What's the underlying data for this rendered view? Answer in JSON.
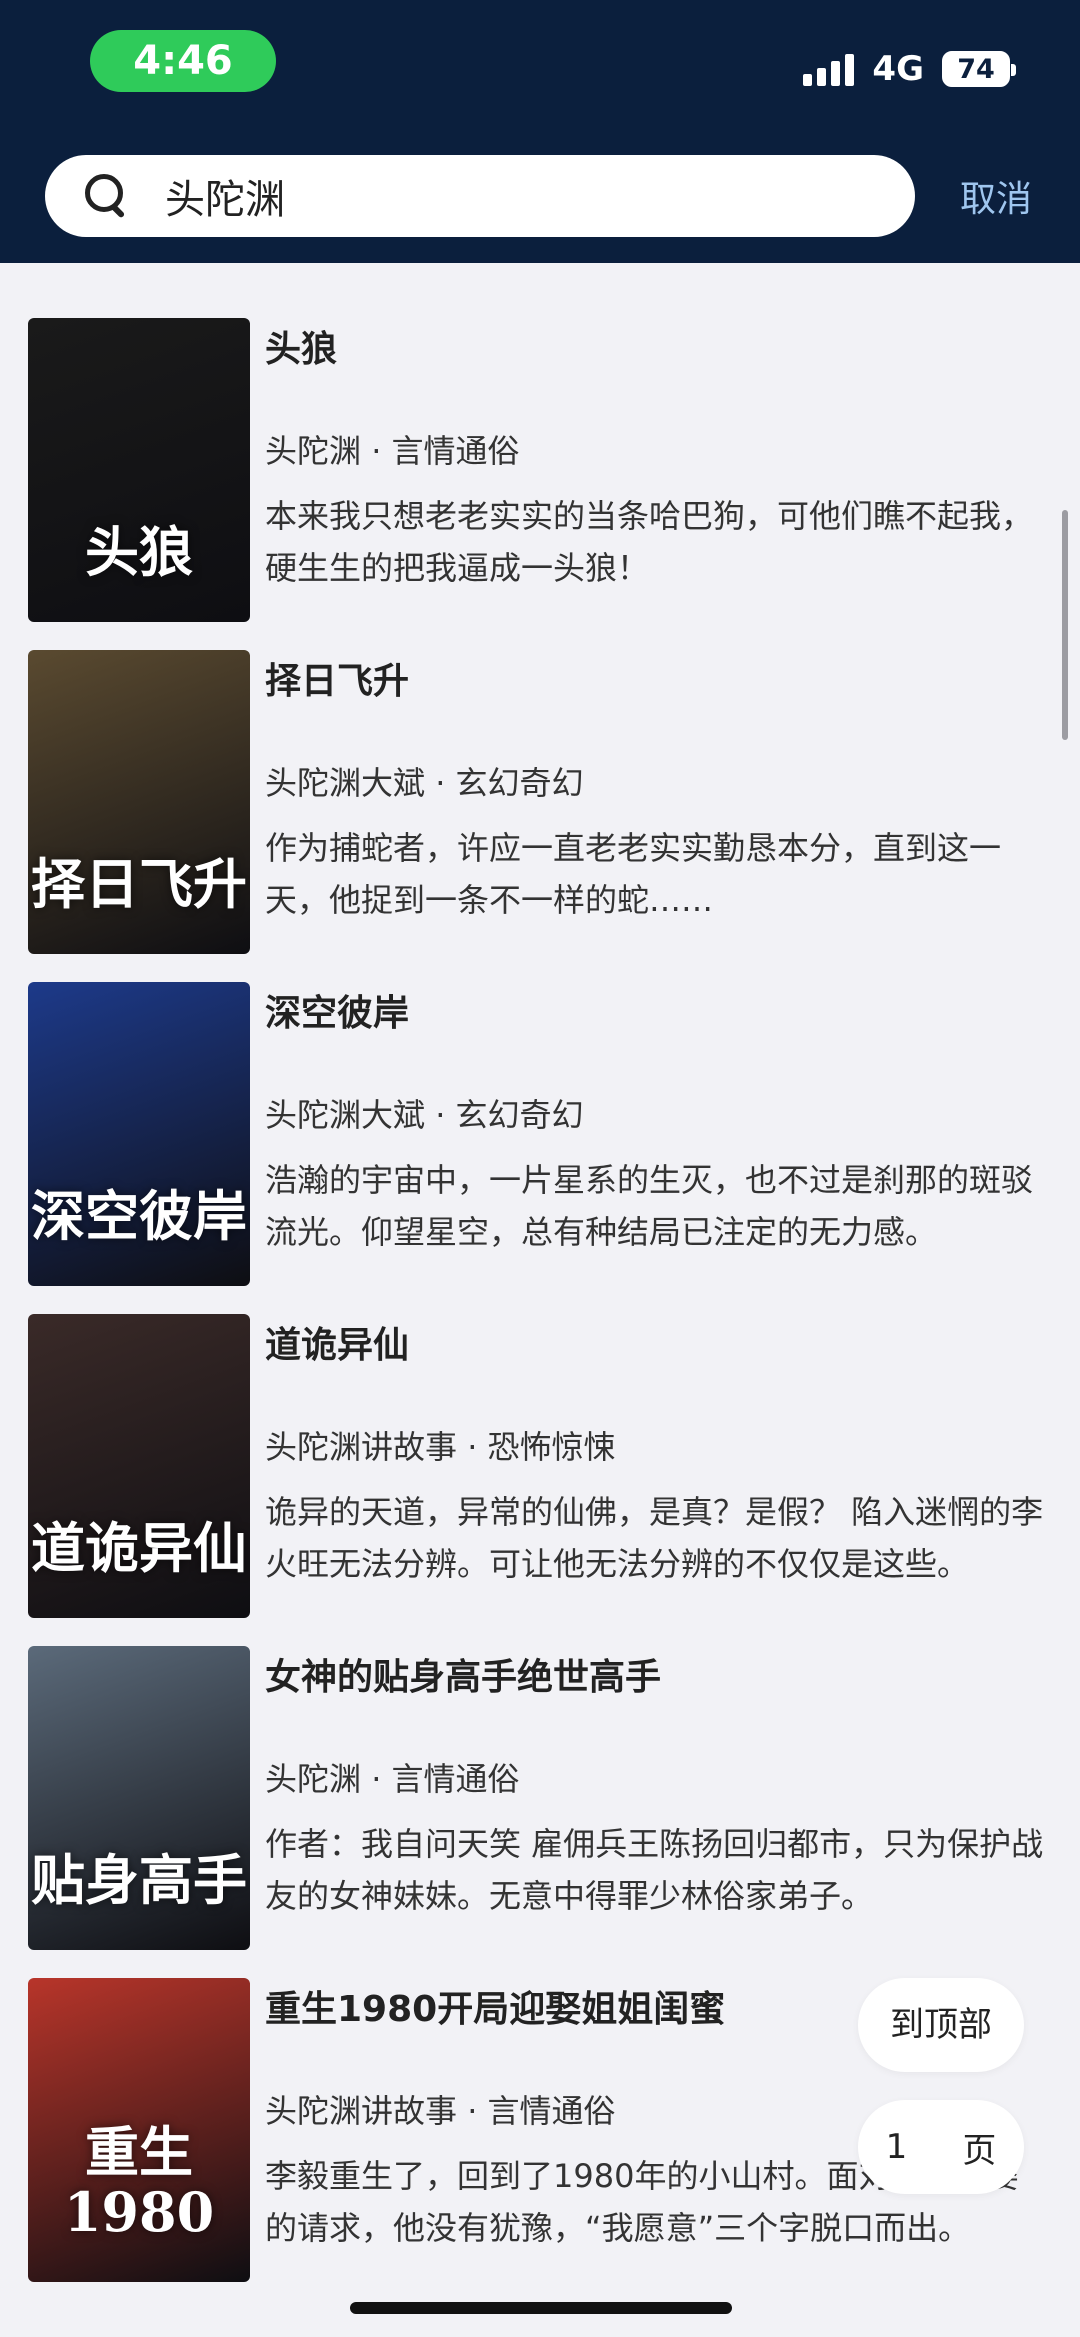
{
  "status_bar": {
    "time": "4:46",
    "network": "4G",
    "battery": "74"
  },
  "search": {
    "query": "头陀渊",
    "cancel_label": "取消"
  },
  "results": [
    {
      "title": "头狼",
      "author": "头陀渊",
      "category": "言情通俗",
      "desc": "本来我只想老老实实的当条哈巴狗，可他们瞧不起我，硬生生的把我逼成一头狼！",
      "cover_text": "头狼",
      "cover_color": "#1a1a1a"
    },
    {
      "title": "择日飞升",
      "author": "头陀渊大斌",
      "category": "玄幻奇幻",
      "desc": "作为捕蛇者，许应一直老老实实勤恳本分，直到这一天，他捉到一条不一样的蛇……",
      "cover_text": "择日飞升",
      "cover_color": "#5a4a30"
    },
    {
      "title": "深空彼岸",
      "author": "头陀渊大斌",
      "category": "玄幻奇幻",
      "desc": "浩瀚的宇宙中，一片星系的生灭，也不过是刹那的斑驳流光。仰望星空，总有种结局已注定的无力感。",
      "cover_text": "深空彼岸",
      "cover_color": "#1d3a8a"
    },
    {
      "title": "道诡异仙",
      "author": "头陀渊讲故事",
      "category": "恐怖惊悚",
      "desc": "诡异的天道，异常的仙佛，是真？是假？ 陷入迷惘的李火旺无法分辨。可让他无法分辨的不仅仅是这些。",
      "cover_text": "道诡异仙",
      "cover_color": "#3a2a28"
    },
    {
      "title": "女神的贴身高手绝世高手",
      "author": "头陀渊",
      "category": "言情通俗",
      "desc": "作者：我自问天笑 雇佣兵王陈扬回归都市，只为保护战友的女神妹妹。无意中得罪少林俗家弟子。",
      "cover_text": "贴身高手",
      "cover_color": "#5b6a7a"
    },
    {
      "title": "重生1980开局迎娶姐姐闺蜜",
      "author": "头陀渊讲故事",
      "category": "言情通俗",
      "desc": "李毅重生了，回到了1980年的小山村。面对唐雪求娶的请求，他没有犹豫，“我愿意”三个字脱口而出。",
      "cover_text": "重生1980",
      "cover_color": "#b8352a"
    }
  ],
  "floating": {
    "to_top_label": "到顶部",
    "page_number": "1",
    "page_unit": "页"
  }
}
